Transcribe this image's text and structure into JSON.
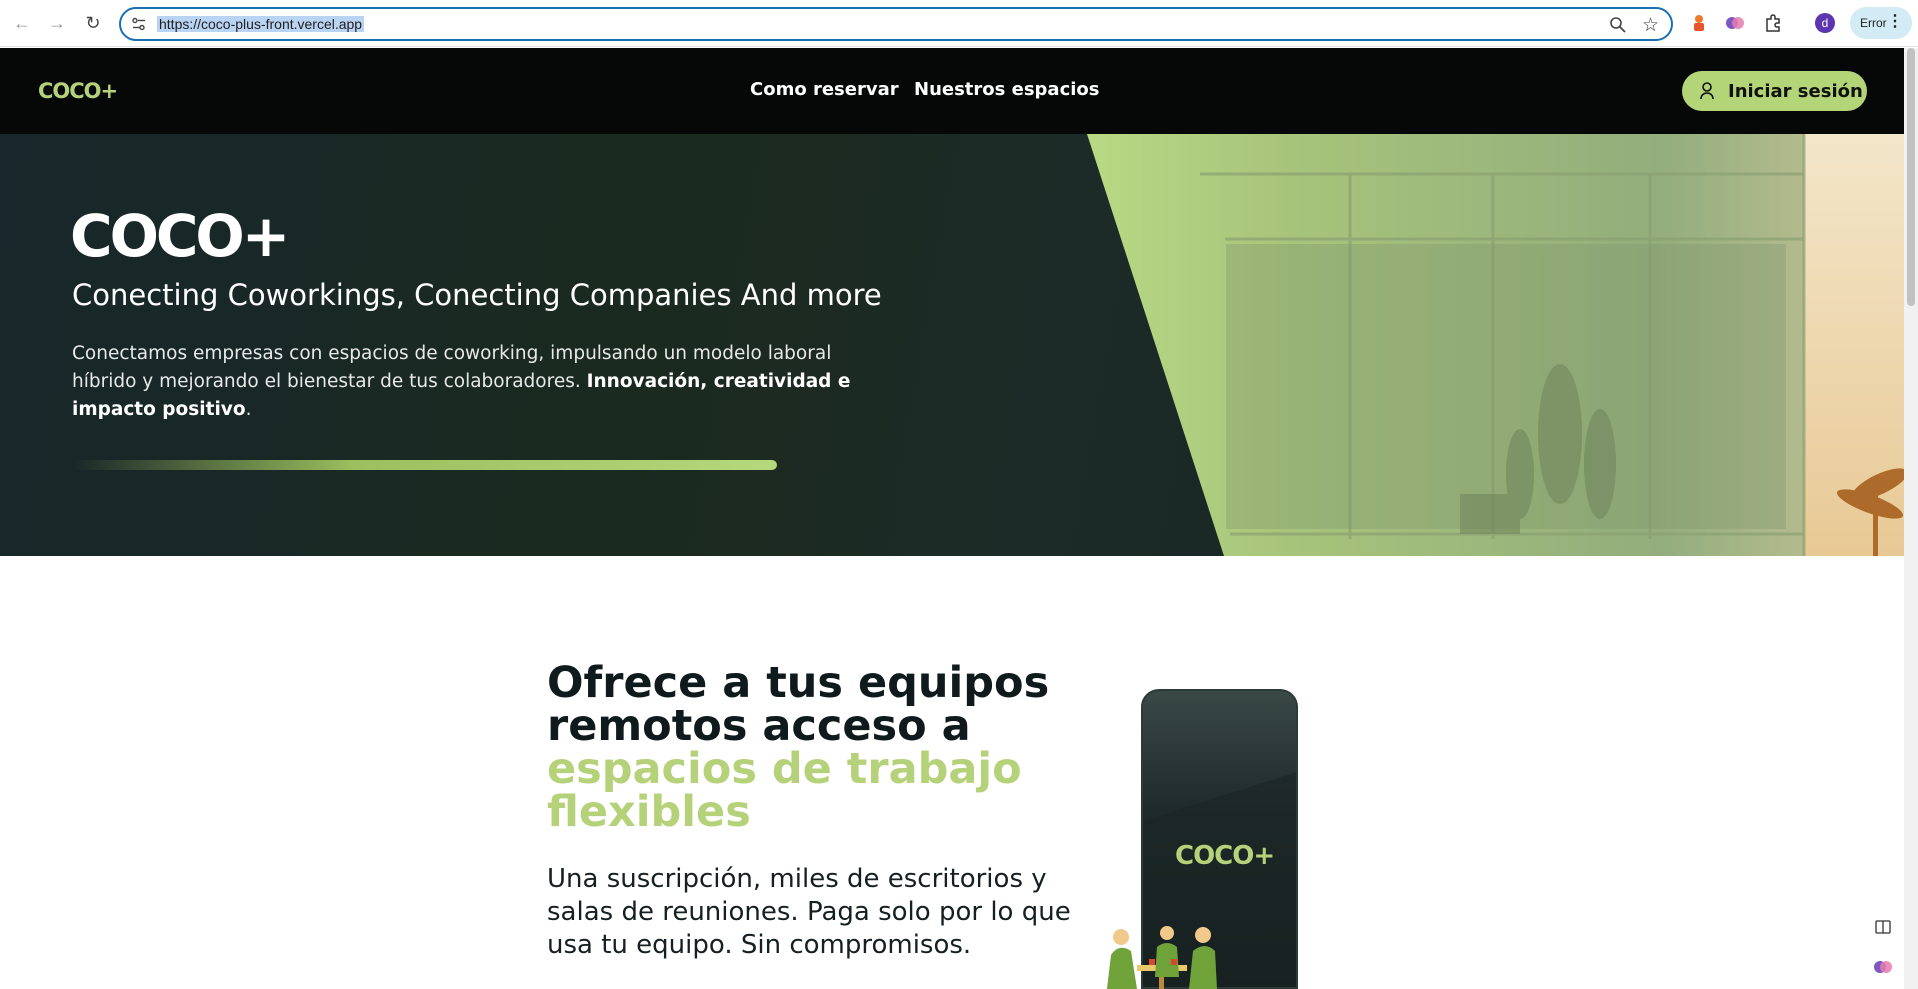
{
  "browser": {
    "url": "https://coco-plus-front.vercel.app",
    "avatar_letter": "d",
    "error_label": "Error"
  },
  "nav": {
    "logo": "COCO+",
    "links": [
      "Como reservar",
      "Nuestros espacios"
    ],
    "login_label": "Iniciar sesión"
  },
  "hero": {
    "logo": "COCO+",
    "title": "Conecting Coworkings, Conecting Companies And more",
    "desc_plain": "Conectamos empresas con espacios de coworking, impulsando un modelo laboral híbrido y mejorando el bienestar de tus colaboradores. ",
    "desc_bold": "Innovación, creatividad e impacto positivo",
    "desc_end": "."
  },
  "section": {
    "headline_line1": "Ofrece a tus equipos",
    "headline_line2": "remotos acceso a",
    "headline_accent1": "espacios de trabajo",
    "headline_accent2": "flexibles",
    "subtext": "Una suscripción, miles de escritorios y salas de reuniones. Paga solo por lo que usa tu equipo. Sin compromisos.",
    "phone_logo": "COCO+"
  },
  "colors": {
    "brand_green": "#b5d27a",
    "nav_bg": "#060707",
    "hero_dark": "#17272b"
  }
}
